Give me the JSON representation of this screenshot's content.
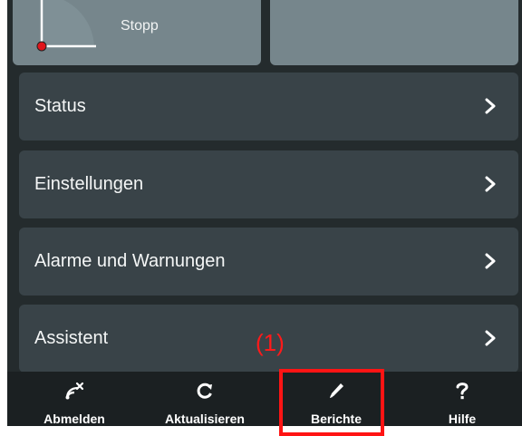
{
  "top_tiles": {
    "left_label": "Stopp"
  },
  "menu": {
    "items": [
      {
        "label": "Status"
      },
      {
        "label": "Einstellungen"
      },
      {
        "label": "Alarme und Warnungen"
      },
      {
        "label": "Assistent"
      }
    ]
  },
  "tabbar": {
    "tabs": [
      {
        "label": "Abmelden",
        "icon": "logout-icon"
      },
      {
        "label": "Aktualisieren",
        "icon": "refresh-icon"
      },
      {
        "label": "Berichte",
        "icon": "pencil-icon"
      },
      {
        "label": "Hilfe",
        "icon": "help-icon"
      }
    ]
  },
  "annotation": {
    "callout": "(1)",
    "color": "#ff1414"
  },
  "colors": {
    "screen_bg": "#242b2d",
    "tile": "#76868c",
    "menu_item": "#394348",
    "tabbar": "#1b2022",
    "gauge_dot": "#e0151b"
  }
}
